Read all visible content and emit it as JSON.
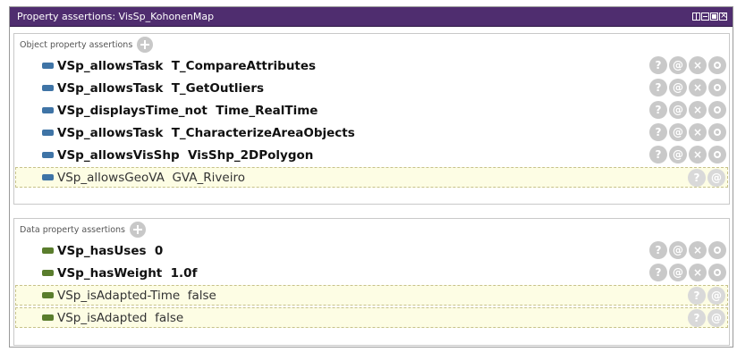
{
  "window": {
    "title": "Property assertions: VisSp_KohonenMap"
  },
  "object_section": {
    "header": "Object property assertions",
    "rows": [
      {
        "text": "VSp_allowsTask  T_CompareAttributes",
        "inferred": false
      },
      {
        "text": "VSp_allowsTask  T_GetOutliers",
        "inferred": false
      },
      {
        "text": "VSp_displaysTime_not  Time_RealTime",
        "inferred": false
      },
      {
        "text": "VSp_allowsTask  T_CharacterizeAreaObjects",
        "inferred": false
      },
      {
        "text": "VSp_allowsVisShp  VisShp_2DPolygon",
        "inferred": false
      },
      {
        "text": "VSp_allowsGeoVA  GVA_Riveiro",
        "inferred": true
      }
    ]
  },
  "data_section": {
    "header": "Data property assertions",
    "rows": [
      {
        "text": "VSp_hasUses  0",
        "inferred": false
      },
      {
        "text": "VSp_hasWeight  1.0f",
        "inferred": false
      },
      {
        "text": "VSp_isAdapted-Time  false",
        "inferred": true
      },
      {
        "text": "VSp_isAdapted  false",
        "inferred": true
      }
    ]
  },
  "actions": {
    "explain": "?",
    "annotate": "@",
    "delete": "×"
  },
  "colors": {
    "titlebar": "#4f2d6f",
    "object_marker": "#3f74a6",
    "data_marker": "#5a7d2d",
    "inferred_bg": "#fdfde4",
    "action_button": "#c9c9c9"
  }
}
